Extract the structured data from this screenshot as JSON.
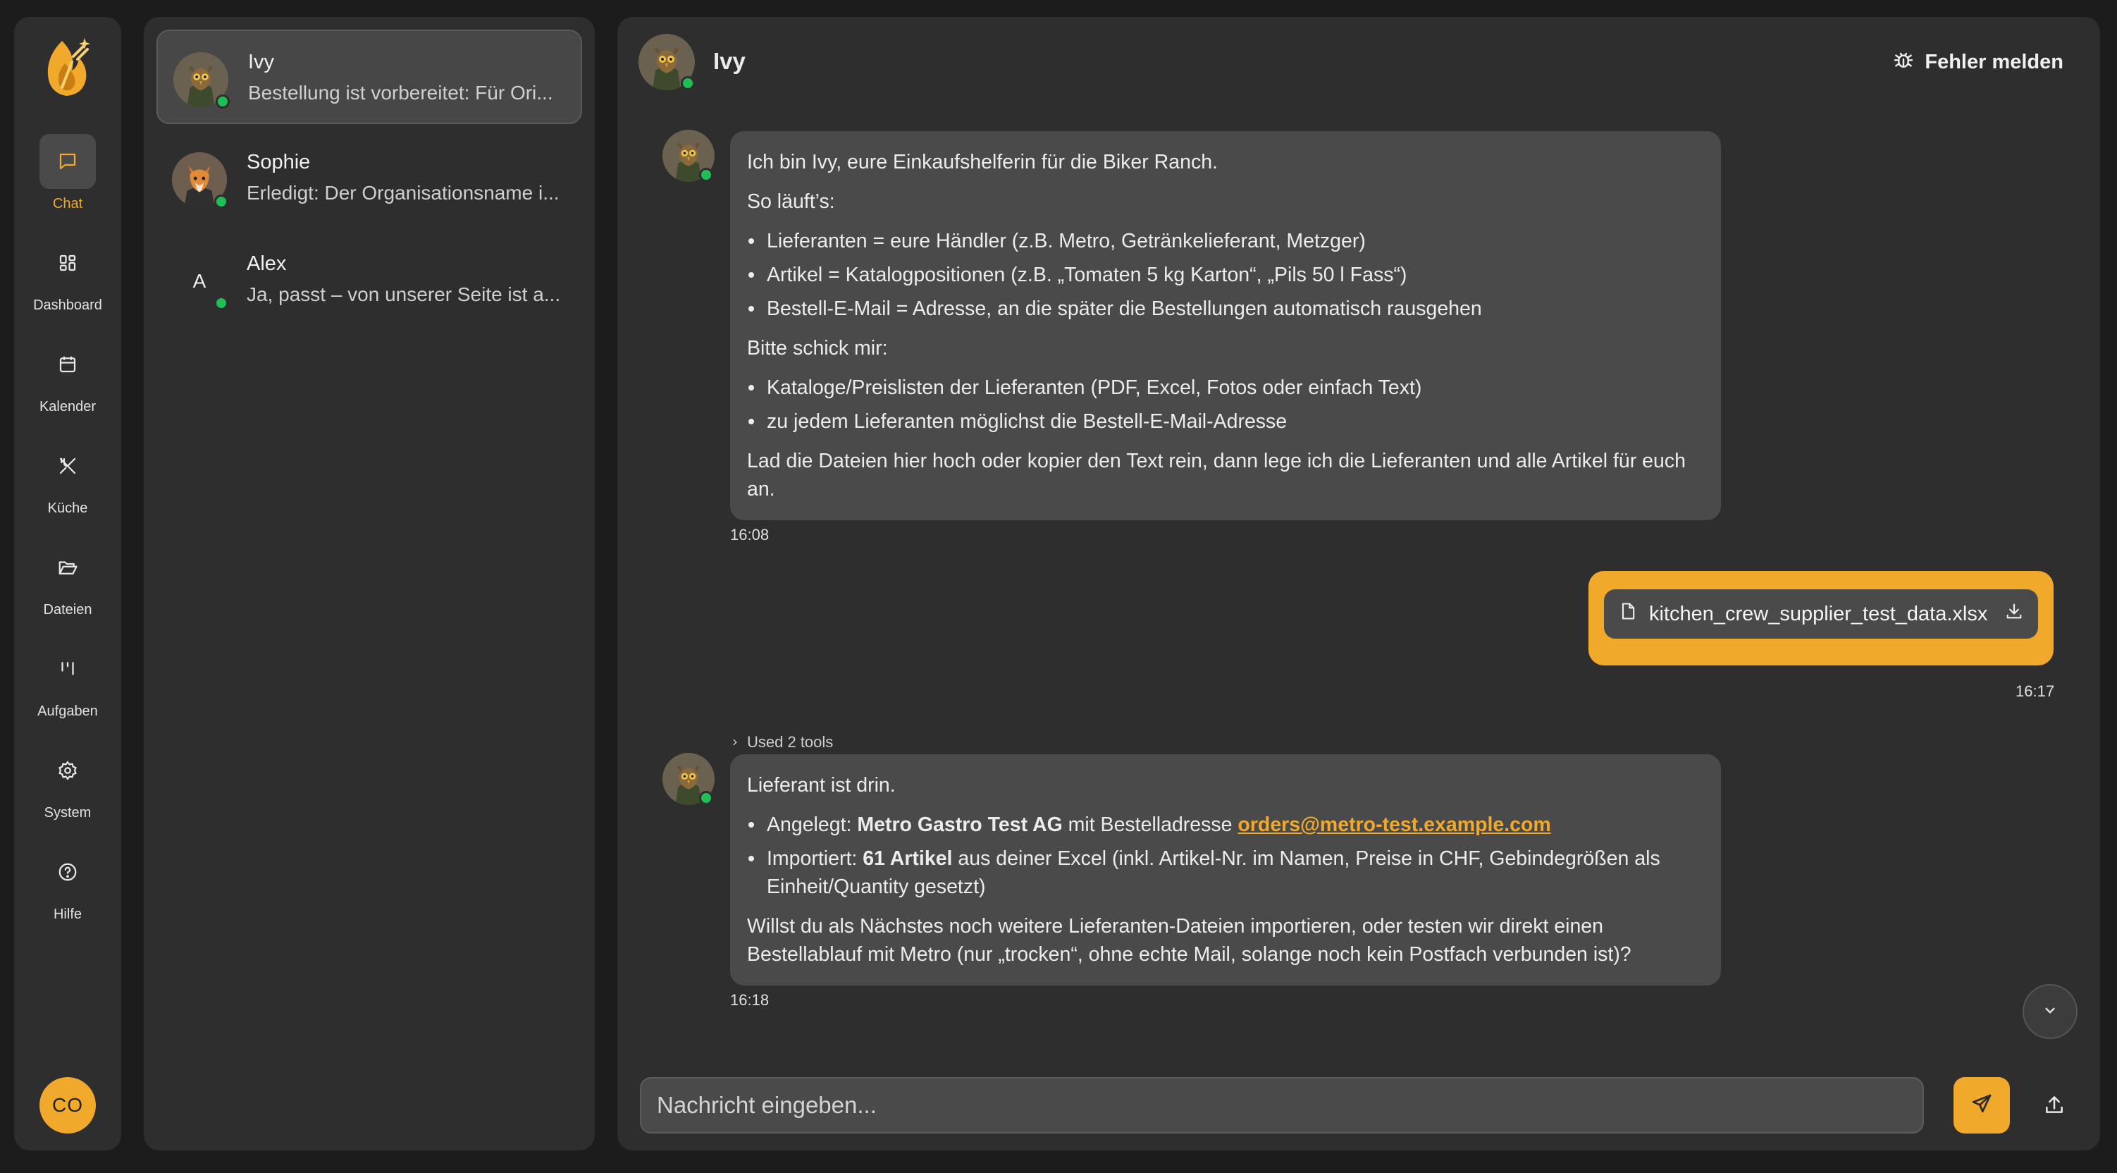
{
  "colors": {
    "accent": "#f0a92a",
    "online": "#1fbf55",
    "panel": "#2e2e2e",
    "bubble": "#4a4a4a"
  },
  "sidebar": {
    "items": [
      {
        "label": "Chat",
        "icon": "chat-bubble-icon",
        "active": true
      },
      {
        "label": "Dashboard",
        "icon": "grid-icon"
      },
      {
        "label": "Kalender",
        "icon": "calendar-icon"
      },
      {
        "label": "Küche",
        "icon": "utensils-icon"
      },
      {
        "label": "Dateien",
        "icon": "folder-open-icon"
      },
      {
        "label": "Aufgaben",
        "icon": "kanban-icon"
      },
      {
        "label": "System",
        "icon": "gear-icon"
      },
      {
        "label": "Hilfe",
        "icon": "help-circle-icon"
      }
    ],
    "user_initials": "CO"
  },
  "conversations": [
    {
      "name": "Ivy",
      "preview": "Bestellung ist vorbereitet: Für Ori...",
      "active": true
    },
    {
      "name": "Sophie",
      "preview": "Erledigt: Der Organisationsname i..."
    },
    {
      "name": "Alex",
      "initial": "A",
      "preview": "Ja, passt – von unserer Seite ist a..."
    }
  ],
  "chat": {
    "header_name": "Ivy",
    "report_label": "Fehler melden",
    "messages": [
      {
        "intro": "Ich bin Ivy, eure Einkaufshelferin für die Biker Ranch.",
        "how": "So läuft’s:",
        "bullets1": [
          "Lieferanten = eure Händler (z.B. Metro, Getränkelieferant, Metzger)",
          "Artikel = Katalogpositionen (z.B. „Tomaten 5 kg Karton“, „Pils 50 l Fass“)",
          "Bestell-E-Mail = Adresse, an die später die Bestellungen automatisch rausgehen"
        ],
        "ask": "Bitte schick mir:",
        "bullets2": [
          "Kataloge/Preislisten der Lieferanten (PDF, Excel, Fotos oder einfach Text)",
          "zu jedem Lieferanten möglichst die Bestell-E-Mail-Adresse"
        ],
        "closing": "Lad die Dateien hier hoch oder kopier den Text rein, dann lege ich die Lieferanten und alle Artikel für euch an.",
        "time": "16:08"
      },
      {
        "file_name": "kitchen_crew_supplier_test_data.xlsx",
        "time": "16:17"
      },
      {
        "tools_label": "Used 2 tools",
        "heading": "Lieferant ist drin.",
        "b1_pre": "Angelegt: ",
        "b1_bold": "Metro Gastro Test AG",
        "b1_mid": " mit Bestelladresse ",
        "b1_link": "orders@metro-test.example.com",
        "b2_pre": "Importiert: ",
        "b2_bold": "61 Artikel",
        "b2_rest": " aus deiner Excel (inkl. Artikel-Nr. im Namen, Preise in CHF, Gebindegrößen als Einheit/Quantity gesetzt)",
        "closing": "Willst du als Nächstes noch weitere Lieferanten-Dateien importieren, oder testen wir direkt einen Bestellablauf mit Metro (nur „trocken“, ohne echte Mail, solange noch kein Postfach verbunden ist)?",
        "time": "16:18"
      }
    ]
  },
  "composer": {
    "placeholder": "Nachricht eingeben..."
  }
}
